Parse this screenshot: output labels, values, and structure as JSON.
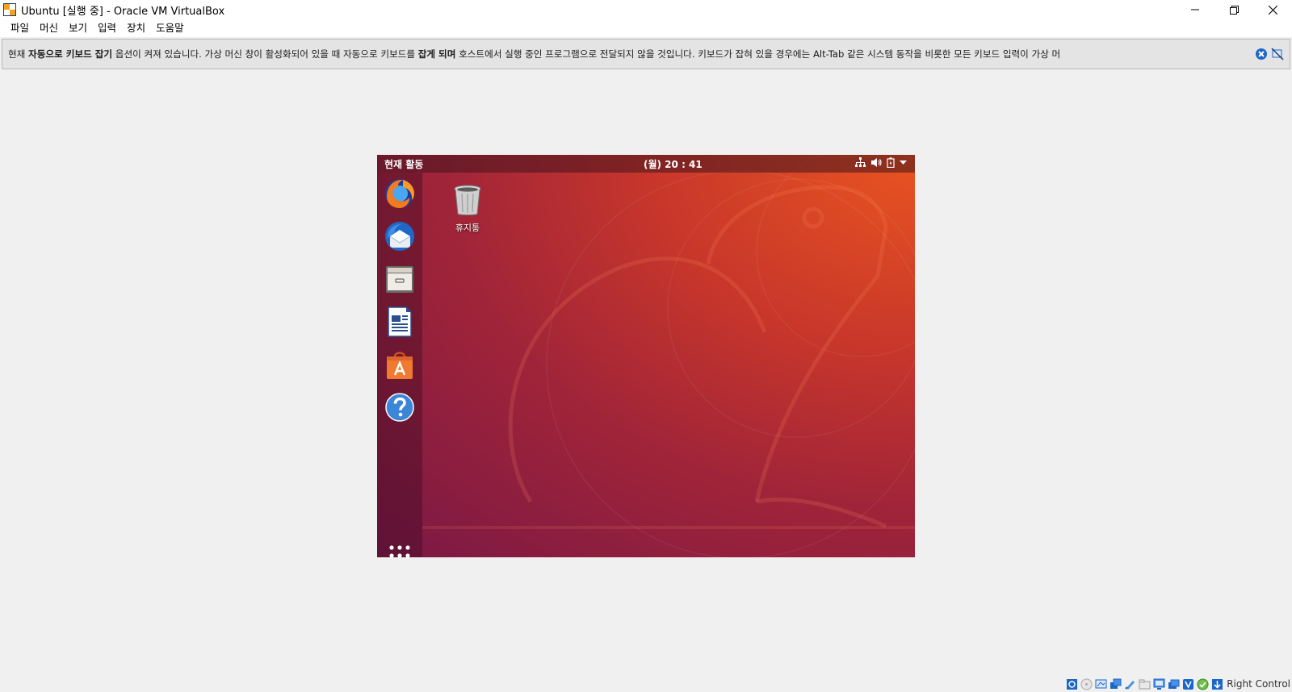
{
  "window": {
    "title": "Ubuntu [실행 중] - Oracle VM VirtualBox",
    "minimize_icon": "minimize-icon",
    "restore_icon": "restore-icon",
    "close_icon": "close-icon"
  },
  "menubar": {
    "items": [
      "파일",
      "머신",
      "보기",
      "입력",
      "장치",
      "도움말"
    ]
  },
  "notice": {
    "part1": "현재 ",
    "bold1": "자동으로 키보드 잡기",
    "part2": " 옵션이 켜져 있습니다. 가상 머신 창이 활성화되어 있을 때 자동으로 키보드를 ",
    "bold2": "잡게 되며",
    "part3": " 호스트에서 실행 중인 프로그램으로 전달되지 않을 것입니다. 키보드가 잡혀 있을 경우에는 Alt-Tab 같은 시스템 동작을 비롯한 모든 키보드 입력이 가상 머"
  },
  "guest": {
    "activities": "현재 활동",
    "clock": "(월) 20 : 41",
    "trash_label": "휴지통",
    "dock_items": [
      "firefox",
      "thunderbird",
      "files",
      "writer",
      "software",
      "help"
    ],
    "colors": {
      "accent": "#e95420",
      "aubergine": "#77216f"
    }
  },
  "statusbar": {
    "host_key": "Right Control"
  }
}
